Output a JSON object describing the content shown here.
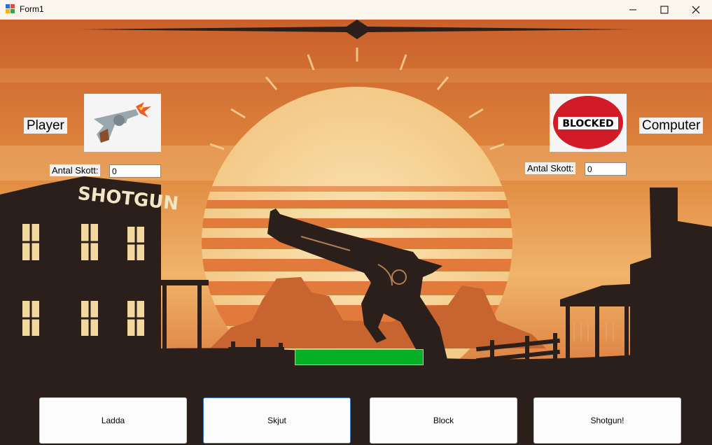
{
  "window": {
    "title": "Form1",
    "controls": {
      "minimize": "–",
      "maximize": "☐",
      "close": "✕"
    }
  },
  "player": {
    "label": "Player",
    "shots_label": "Antal Skott:",
    "shots_value": "0",
    "image_icon": "revolver-firing-icon"
  },
  "computer": {
    "label": "Computer",
    "shots_label": "Antal Skott:",
    "shots_value": "0",
    "image_text": "BLOCKED"
  },
  "sign": {
    "text": "SHOTGUN"
  },
  "progress": {
    "value": 1.0,
    "color": "#06b025"
  },
  "buttons": {
    "reload": "Ladda",
    "shoot": "Skjut",
    "block": "Block",
    "shotgun": "Shotgun!"
  },
  "colors": {
    "sky_top": "#d3682e",
    "sun": "#f6d79a",
    "silhouette": "#2a1f1a"
  }
}
